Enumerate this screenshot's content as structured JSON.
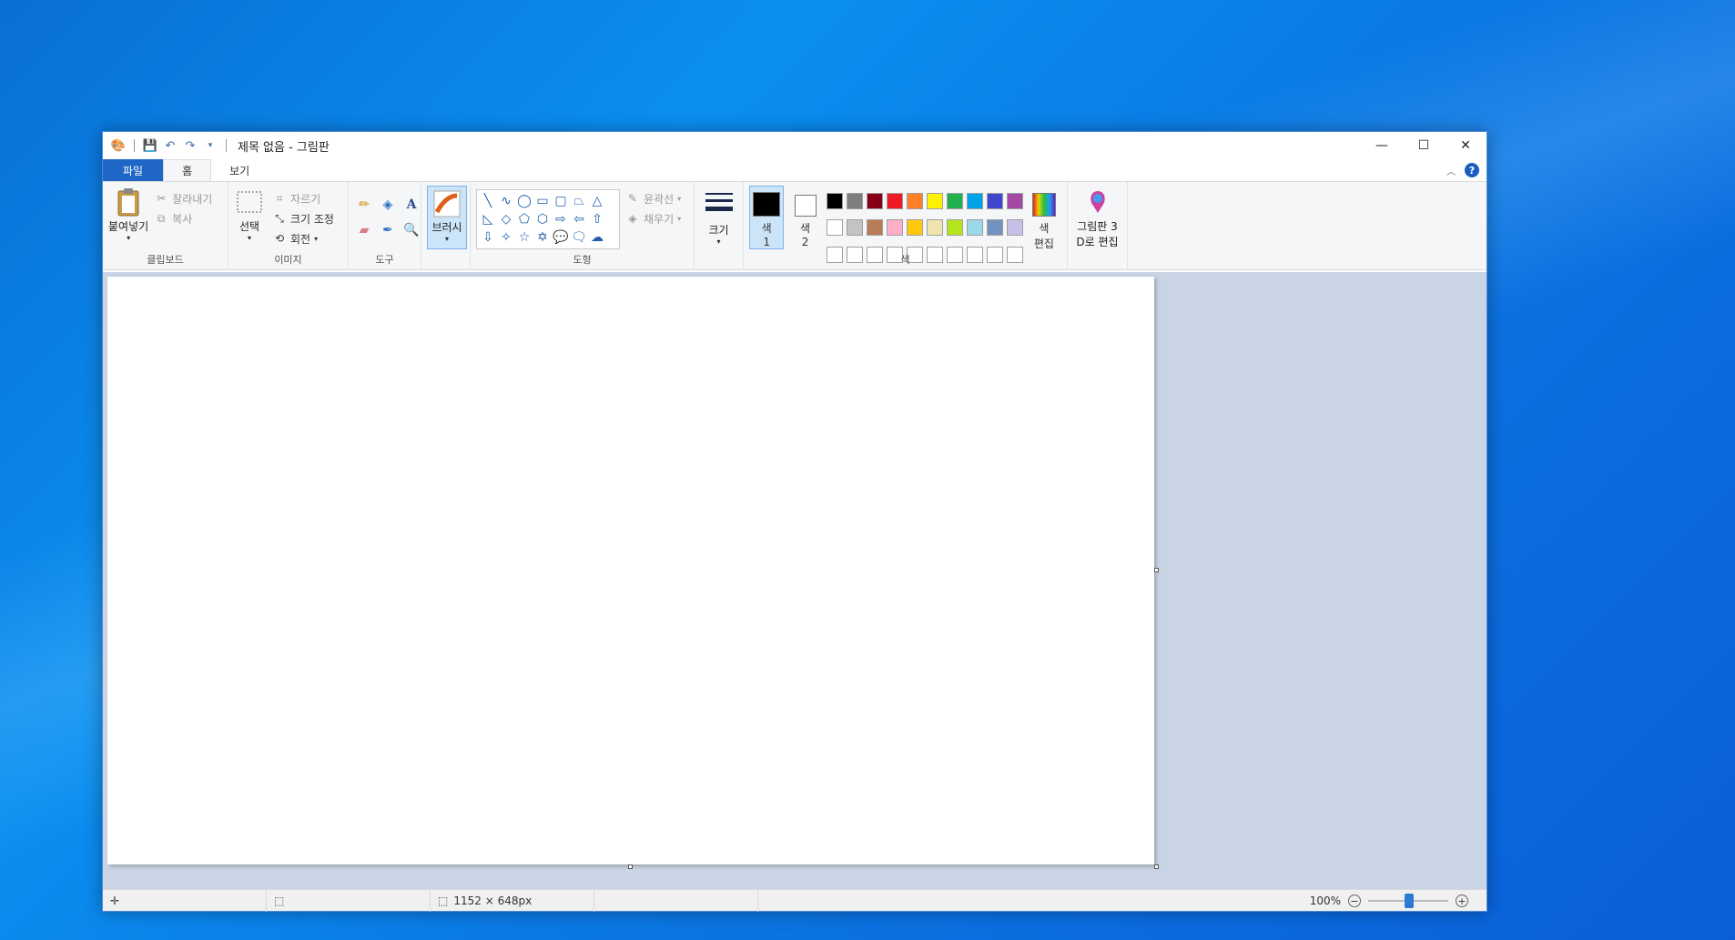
{
  "window": {
    "title": "제목 없음 - 그림판"
  },
  "tabs": [
    {
      "label": "파일"
    },
    {
      "label": "홈"
    },
    {
      "label": "보기"
    }
  ],
  "ribbon": {
    "clipboard": {
      "label": "클립보드",
      "paste": "붙여넣기",
      "cut": "잘라내기",
      "copy": "복사"
    },
    "image": {
      "label": "이미지",
      "select": "선택",
      "crop": "자르기",
      "resize": "크기 조정",
      "rotate": "회전"
    },
    "tools": {
      "label": "도구"
    },
    "brush": {
      "label": "브러시"
    },
    "shapes": {
      "label": "도형",
      "outline": "윤곽선",
      "fill": "채우기"
    },
    "size": {
      "label": "크기"
    },
    "colors": {
      "label": "색",
      "color1_line1": "색",
      "color1_line2": "1",
      "color2_line1": "색",
      "color2_line2": "2",
      "edit_line1": "색",
      "edit_line2": "편집",
      "color1": "#000000",
      "color2": "#ffffff",
      "palette": [
        "#000000",
        "#7f7f7f",
        "#880015",
        "#ed1c24",
        "#ff7f27",
        "#fff200",
        "#22b14c",
        "#00a2e8",
        "#3f48cc",
        "#a349a4",
        "#ffffff",
        "#c3c3c3",
        "#b97a57",
        "#ffaec9",
        "#ffc90e",
        "#efe4b0",
        "#b5e61d",
        "#99d9ea",
        "#7092be",
        "#c8bfe7",
        "#ffffff",
        "#ffffff",
        "#ffffff",
        "#ffffff",
        "#ffffff",
        "#ffffff",
        "#ffffff",
        "#ffffff",
        "#ffffff",
        "#ffffff"
      ]
    },
    "paint3d": {
      "line1": "그림판 3",
      "line2": "D로 편집"
    }
  },
  "status": {
    "dimensions": "1152 × 648px",
    "zoom": "100%"
  }
}
